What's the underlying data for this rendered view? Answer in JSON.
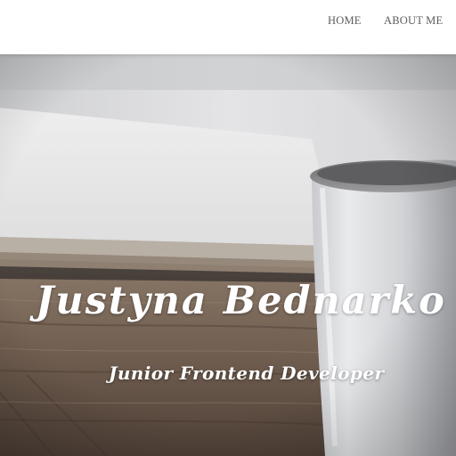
{
  "nav": {
    "items": [
      {
        "label": "HOME"
      },
      {
        "label": "ABOUT ME"
      }
    ]
  },
  "hero": {
    "name": "Justyna Bednarko",
    "subtitle": "Junior Frontend Developer",
    "image": "notebook-and-coffee-mug-on-wooden-table"
  },
  "colors": {
    "nav_background": "#ffffff",
    "nav_text": "#5c5c5c",
    "hero_text": "#ffffff"
  }
}
